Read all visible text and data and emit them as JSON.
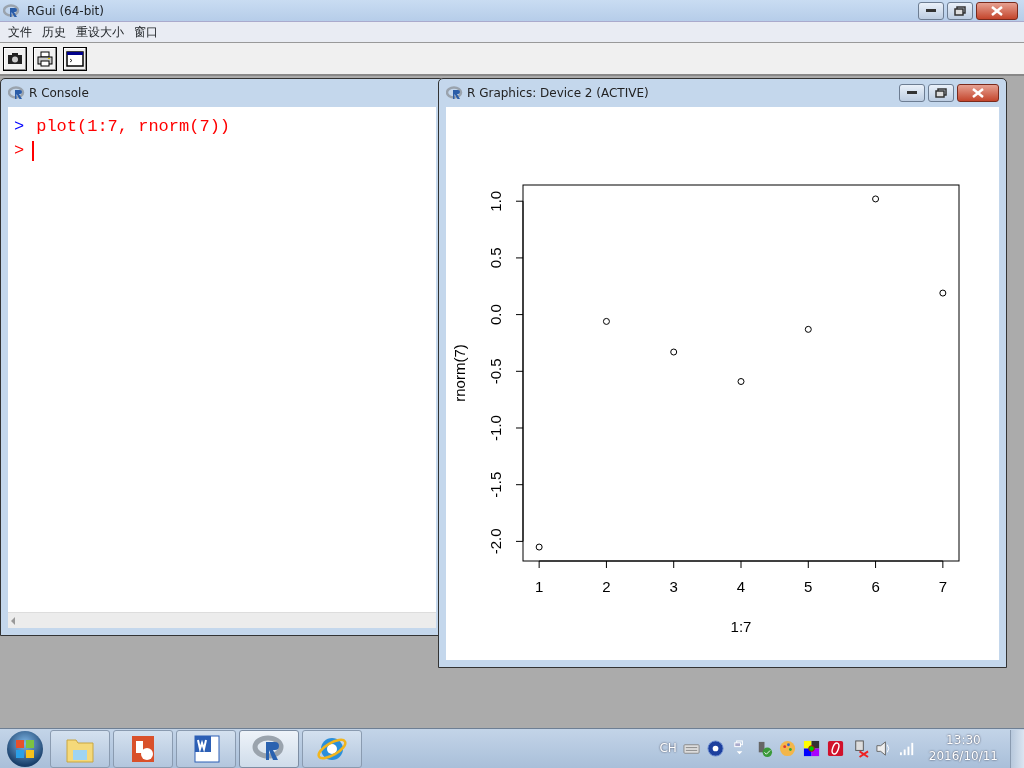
{
  "app": {
    "title": "RGui (64-bit)"
  },
  "menu": [
    "文件",
    "历史",
    "重设大小",
    "窗口"
  ],
  "console": {
    "title": "R Console",
    "lines": [
      {
        "prompt": ">",
        "color": "#0000ff",
        "text": "plot(1:7, rnorm(7))"
      },
      {
        "prompt": ">",
        "color": "#ff0000",
        "cursor": true
      }
    ]
  },
  "graphics": {
    "title": "R Graphics: Device 2 (ACTIVE)",
    "chart_data": {
      "type": "scatter",
      "xlabel": "1:7",
      "ylabel": "rnorm(7)",
      "x": [
        1,
        2,
        3,
        4,
        5,
        6,
        7
      ],
      "series": [
        {
          "color": "#000000",
          "values": [
            -2.05,
            -0.06,
            -0.33,
            -0.59,
            -0.13,
            1.02,
            0.19
          ]
        }
      ],
      "xlim": [
        0.76,
        7.24
      ],
      "ylim": [
        -2.173,
        1.143
      ],
      "xticks": [
        1,
        2,
        3,
        4,
        5,
        6,
        7
      ],
      "yticks": [
        {
          "value": -2,
          "label": "-2.0"
        },
        {
          "value": -1.5,
          "label": "-1.5"
        },
        {
          "value": -1,
          "label": "-1.0"
        },
        {
          "value": -0.5,
          "label": "-0.5"
        },
        {
          "value": 0,
          "label": "0.0"
        },
        {
          "value": 0.5,
          "label": "0.5"
        },
        {
          "value": 1,
          "label": "1.0"
        }
      ]
    }
  },
  "taskbar": {
    "buttons": [
      {
        "selected": false
      },
      {
        "selected": false
      },
      {
        "selected": false
      },
      {
        "selected": true
      },
      {
        "selected": false
      }
    ],
    "tray": {
      "language": "CH",
      "time": "13:30",
      "date": "2016/10/11"
    }
  }
}
